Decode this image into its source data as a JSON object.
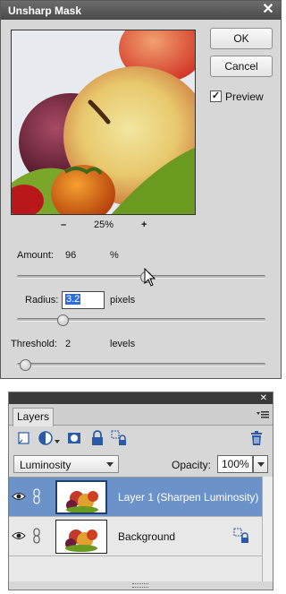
{
  "dialog": {
    "title": "Unsharp Mask",
    "ok_label": "OK",
    "cancel_label": "Cancel",
    "preview_label": "Preview",
    "preview_checked": true,
    "zoom": {
      "minus": "–",
      "value": "25%",
      "plus": "+"
    },
    "amount": {
      "label": "Amount:",
      "value": "96",
      "unit": "%",
      "slider_fraction": 0.52
    },
    "radius": {
      "label": "Radius:",
      "value": "3.2",
      "unit": "pixels",
      "slider_fraction": 0.17
    },
    "threshold": {
      "label": "Threshold:",
      "value": "2",
      "unit": "levels",
      "slider_fraction": 0.01
    }
  },
  "layers_panel": {
    "tab_label": "Layers",
    "blend_mode": "Luminosity",
    "opacity_label": "Opacity:",
    "opacity_value": "100%",
    "layers": [
      {
        "name": "Layer 1  (Sharpen Luminosity)",
        "selected": true
      },
      {
        "name": "Background",
        "selected": false
      }
    ]
  },
  "colors": {
    "selection": "#6b93c9",
    "panel_bg": "#d7d7d7",
    "title_bar": "#4a4a4a",
    "accent_blue": "#2f6bd6"
  },
  "icons": [
    "close-icon",
    "checkmark-icon",
    "cursor-icon",
    "new-layer-icon",
    "adjustment-layer-icon",
    "layer-mask-icon",
    "lock-icon",
    "lock-all-icon",
    "trash-icon",
    "eye-icon",
    "link-icon",
    "panel-menu-icon"
  ]
}
